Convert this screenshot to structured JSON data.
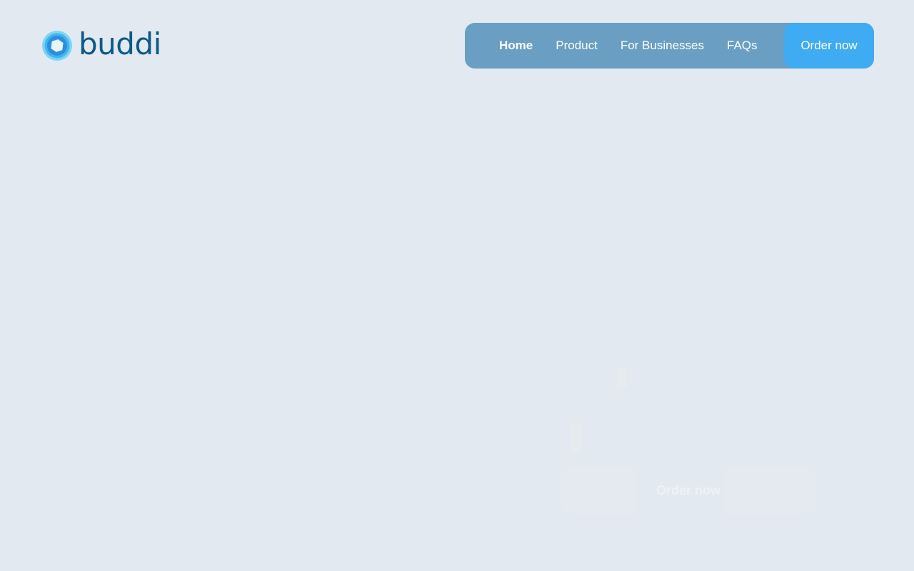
{
  "brand": {
    "name": "buddi",
    "logo_icon": "buddi-ring-logo-icon"
  },
  "nav": {
    "links": [
      {
        "label": "Home",
        "active": true
      },
      {
        "label": "Product",
        "active": false
      },
      {
        "label": "For Businesses",
        "active": false
      },
      {
        "label": "FAQs",
        "active": false
      }
    ],
    "cta_label": "Order now"
  },
  "hero_faded": {
    "cta_label": "Order now"
  },
  "colors": {
    "page_background": "#e2e9f1",
    "nav_background": "#6a9ec2",
    "cta_background": "#3eabf2",
    "brand_text": "#0d5a88",
    "logo_outer": "#59c9ef",
    "logo_inner": "#2a8fe0"
  }
}
